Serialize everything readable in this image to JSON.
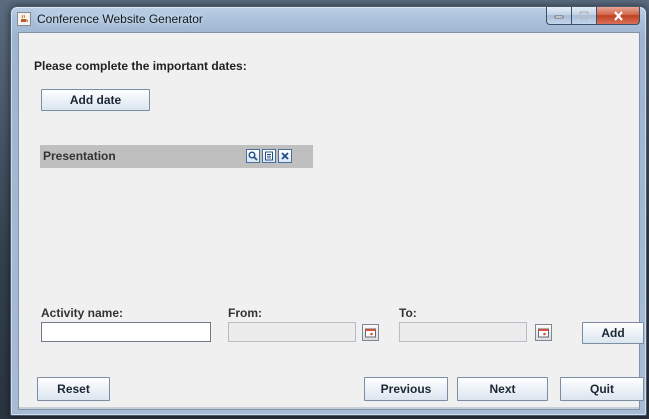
{
  "window": {
    "title": "Conference Website Generator"
  },
  "main": {
    "heading": "Please complete the important dates:",
    "add_date_label": "Add date",
    "dates": [
      {
        "label": "Presentation"
      }
    ]
  },
  "activity_form": {
    "activity_label": "Activity name:",
    "from_label": "From:",
    "to_label": "To:",
    "activity_value": "",
    "from_value": "",
    "to_value": "",
    "add_label": "Add"
  },
  "footer": {
    "reset_label": "Reset",
    "previous_label": "Previous",
    "next_label": "Next",
    "quit_label": "Quit"
  },
  "icons": {
    "app": "java-cup-icon",
    "view": "magnifier-icon",
    "edit": "list-edit-icon",
    "delete": "close-x-icon",
    "calendar": "calendar-icon"
  },
  "colors": {
    "client_bg": "#f0f0f0",
    "row_bg": "#bfbfbf",
    "close_button": "#c0401f",
    "icon_border": "#4c6f97"
  }
}
